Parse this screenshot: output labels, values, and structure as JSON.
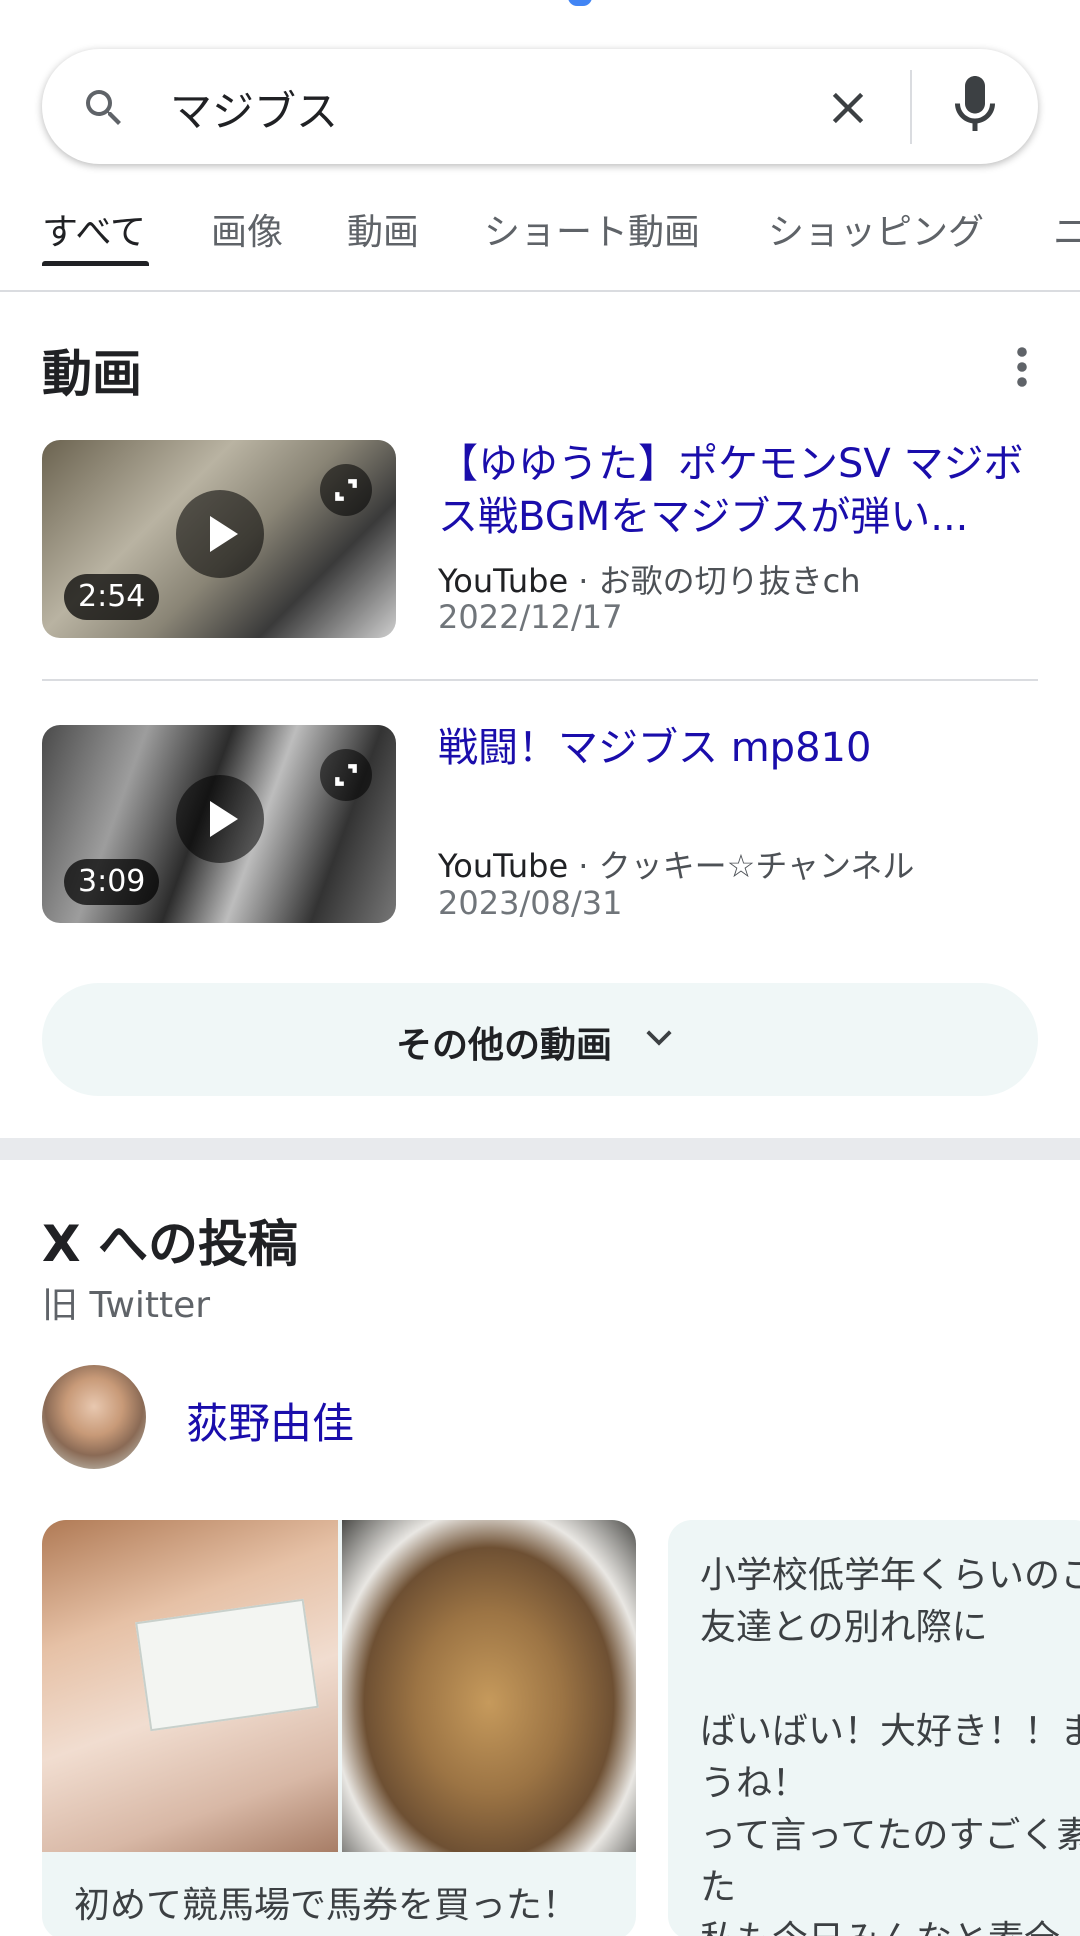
{
  "search": {
    "query": "マジブス"
  },
  "tabs": [
    "すべて",
    "画像",
    "動画",
    "ショート動画",
    "ショッピング",
    "ニ"
  ],
  "videos_section": {
    "title": "動画",
    "items": [
      {
        "title": "【ゆゆうた】ポケモンSV マジボス戦BGMをマジブスが弾い...",
        "source": "YouTube",
        "channel": "お歌の切り抜きch",
        "date": "2022/12/17",
        "duration": "2:54"
      },
      {
        "title": "戦闘！マジブス mp810",
        "source": "YouTube",
        "channel": "クッキー☆チャンネル",
        "date": "2023/08/31",
        "duration": "3:09"
      }
    ],
    "more_label": "その他の動画"
  },
  "x_section": {
    "title": "X への投稿",
    "subtitle": "旧 Twitter",
    "author": "荻野由佳",
    "posts": [
      {
        "text": "初めて競馬場で馬券を買った！"
      },
      {
        "text": "小学校低学年くらいのこ\n友達との別れ際に\n\nばいばい！大好き！！ま\nうね！\nって言ってたのすごく素\nた\n私も今日みんなと素全"
      }
    ]
  },
  "colors": {
    "link_blue": "#1a0dab",
    "accent_blue": "#4285f4"
  },
  "icons": [
    "search-icon",
    "clear-icon",
    "mic-icon",
    "kebab-icon",
    "play-icon",
    "expand-icon",
    "chevron-down-icon"
  ]
}
